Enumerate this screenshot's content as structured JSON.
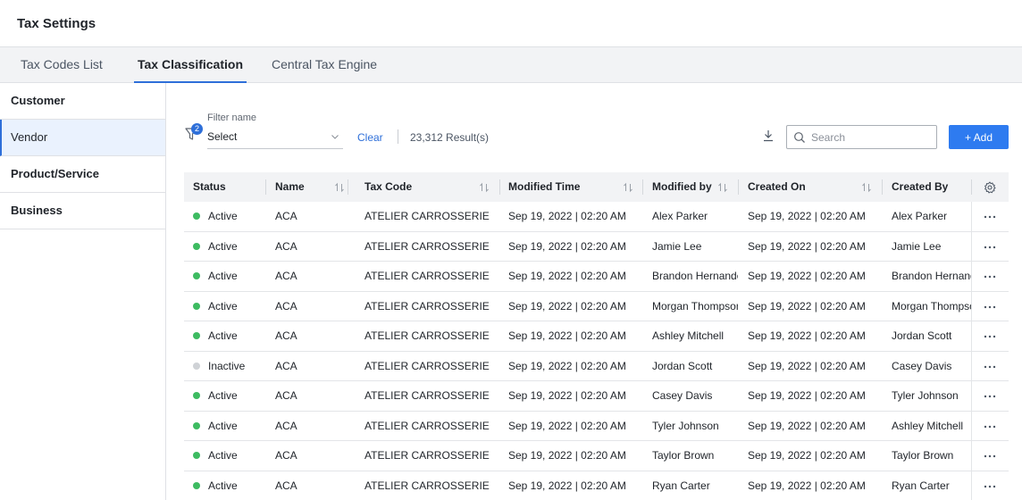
{
  "page": {
    "title": "Tax Settings"
  },
  "tabs": [
    {
      "label": "Tax Codes List",
      "active": false
    },
    {
      "label": "Tax Classification",
      "active": true
    },
    {
      "label": "Central Tax Engine",
      "active": false
    }
  ],
  "sidebar": {
    "items": [
      {
        "label": "Customer",
        "active": false
      },
      {
        "label": "Vendor",
        "active": true
      },
      {
        "label": "Product/Service",
        "active": false
      },
      {
        "label": "Business",
        "active": false
      }
    ]
  },
  "toolbar": {
    "filter_badge": "2",
    "filter_label": "Filter name",
    "filter_value": "Select",
    "clear_label": "Clear",
    "results_text": "23,312 Result(s)",
    "search_placeholder": "Search",
    "add_label": "+ Add"
  },
  "table": {
    "columns": [
      {
        "label": "Status",
        "sortable": false
      },
      {
        "label": "Name",
        "sortable": true
      },
      {
        "label": "Tax Code",
        "sortable": true
      },
      {
        "label": "Modified Time",
        "sortable": true
      },
      {
        "label": "Modified by",
        "sortable": true
      },
      {
        "label": "Created On",
        "sortable": true
      },
      {
        "label": "Created By",
        "sortable": false
      }
    ],
    "rows": [
      {
        "status": "Active",
        "name": "ACA",
        "tax_code": "ATELIER CARROSSERIE",
        "modified_time": "Sep 19, 2022 | 02:20 AM",
        "modified_by": "Alex Parker",
        "created_on": "Sep 19, 2022 | 02:20 AM",
        "created_by": "Alex Parker"
      },
      {
        "status": "Active",
        "name": "ACA",
        "tax_code": "ATELIER CARROSSERIE",
        "modified_time": "Sep 19, 2022 | 02:20 AM",
        "modified_by": "Jamie Lee",
        "created_on": "Sep 19, 2022 | 02:20 AM",
        "created_by": "Jamie Lee"
      },
      {
        "status": "Active",
        "name": "ACA",
        "tax_code": "ATELIER CARROSSERIE",
        "modified_time": "Sep 19, 2022 | 02:20 AM",
        "modified_by": "Brandon Hernande",
        "created_on": "Sep 19, 2022 | 02:20 AM",
        "created_by": "Brandon Hernand"
      },
      {
        "status": "Active",
        "name": "ACA",
        "tax_code": "ATELIER CARROSSERIE",
        "modified_time": "Sep 19, 2022 | 02:20 AM",
        "modified_by": "Morgan Thompson",
        "created_on": "Sep 19, 2022 | 02:20 AM",
        "created_by": "Morgan Thompso"
      },
      {
        "status": "Active",
        "name": "ACA",
        "tax_code": "ATELIER CARROSSERIE",
        "modified_time": "Sep 19, 2022 | 02:20 AM",
        "modified_by": "Ashley Mitchell",
        "created_on": "Sep 19, 2022 | 02:20 AM",
        "created_by": "Jordan Scott"
      },
      {
        "status": "Inactive",
        "name": "ACA",
        "tax_code": "ATELIER CARROSSERIE",
        "modified_time": "Sep 19, 2022 | 02:20 AM",
        "modified_by": "Jordan Scott",
        "created_on": "Sep 19, 2022 | 02:20 AM",
        "created_by": "Casey Davis"
      },
      {
        "status": "Active",
        "name": "ACA",
        "tax_code": "ATELIER CARROSSERIE",
        "modified_time": "Sep 19, 2022 | 02:20 AM",
        "modified_by": "Casey Davis",
        "created_on": "Sep 19, 2022 | 02:20 AM",
        "created_by": "Tyler Johnson"
      },
      {
        "status": "Active",
        "name": "ACA",
        "tax_code": "ATELIER CARROSSERIE",
        "modified_time": "Sep 19, 2022 | 02:20 AM",
        "modified_by": "Tyler Johnson",
        "created_on": "Sep 19, 2022 | 02:20 AM",
        "created_by": "Ashley Mitchell"
      },
      {
        "status": "Active",
        "name": "ACA",
        "tax_code": "ATELIER CARROSSERIE",
        "modified_time": "Sep 19, 2022 | 02:20 AM",
        "modified_by": "Taylor Brown",
        "created_on": "Sep 19, 2022 | 02:20 AM",
        "created_by": "Taylor Brown"
      },
      {
        "status": "Active",
        "name": "ACA",
        "tax_code": "ATELIER CARROSSERIE",
        "modified_time": "Sep 19, 2022 | 02:20 AM",
        "modified_by": "Ryan Carter",
        "created_on": "Sep 19, 2022 | 02:20 AM",
        "created_by": "Ryan Carter"
      }
    ]
  },
  "icons": {
    "filter": "filter-icon",
    "chevron": "chevron-down-icon",
    "download": "download-icon",
    "search": "search-icon",
    "sort": "sort-icon",
    "settings": "gear-icon",
    "row_menu": "more-horizontal-icon"
  },
  "colors": {
    "accent": "#2e6fd9",
    "button": "#2e7bf0",
    "status_active": "#3dbb61",
    "status_inactive": "#cfd2d6"
  }
}
